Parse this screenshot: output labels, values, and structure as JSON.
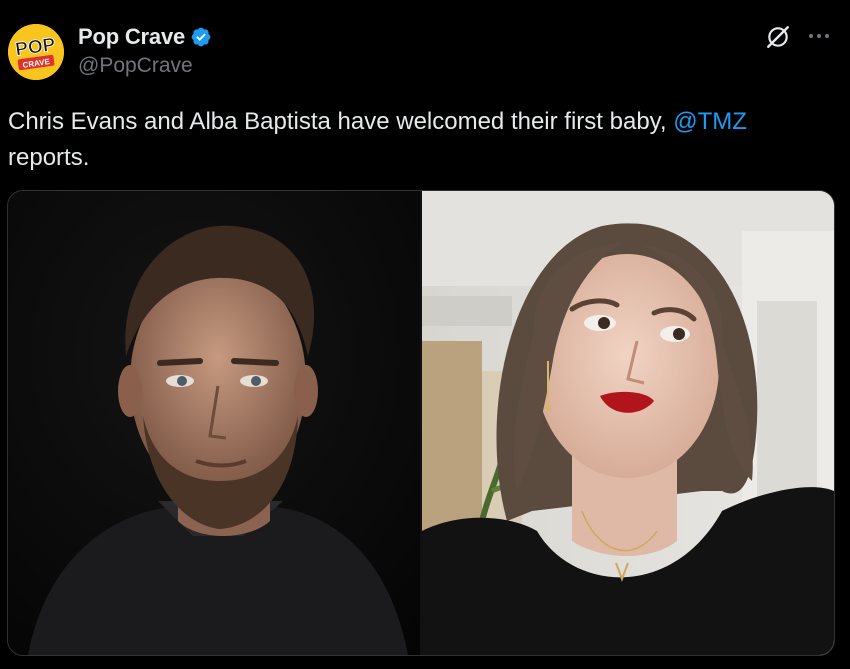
{
  "account": {
    "display_name": "Pop Crave",
    "handle": "@PopCrave",
    "avatar_top": "POP",
    "avatar_bottom": "CRAVE",
    "verified_icon": "verified-badge-icon"
  },
  "post": {
    "text_before": "Chris Evans and Alba Baptista have welcomed their first baby, ",
    "mention": "@TMZ",
    "text_after": "reports."
  },
  "actions": {
    "grok_icon": "grok-icon",
    "more_icon": "more-icon"
  },
  "colors": {
    "background": "#000000",
    "text": "#e7e9ea",
    "secondary": "#71767b",
    "accent": "#1d9bf0",
    "avatar_bg": "#f7c51e"
  }
}
